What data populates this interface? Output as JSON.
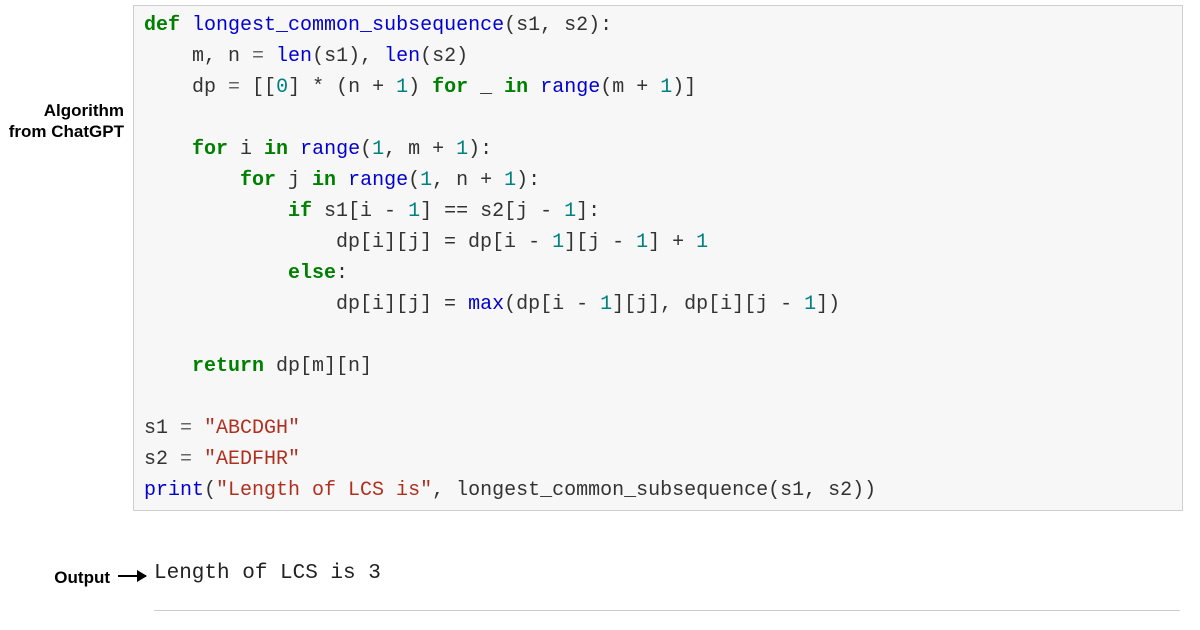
{
  "labels": {
    "algorithm_line1": "Algorithm",
    "algorithm_line2": "from ChatGPT",
    "output": "Output"
  },
  "code": {
    "line1": {
      "def": "def",
      "fname": "longest_common_subsequence",
      "params": "(s1, s2):"
    },
    "line2": {
      "lhs": "m, n",
      "eq": " = ",
      "len1": "len",
      "a1": "(s1), ",
      "len2": "len",
      "a2": "(s2)"
    },
    "line3": {
      "dp": "dp",
      "eq": " = ",
      "open": "[[",
      "zero": "0",
      "rest1": "] * (n + ",
      "one1": "1",
      "rest2": ") ",
      "for": "for",
      "under": " _ ",
      "in": "in",
      "sp": " ",
      "range": "range",
      "rest3": "(m + ",
      "one2": "1",
      "rest4": ")]"
    },
    "line5": {
      "for": "for",
      "var": " i ",
      "in": "in",
      "sp": " ",
      "range": "range",
      "args": "(",
      "one": "1",
      "rest": ", m + ",
      "one2": "1",
      "close": "):"
    },
    "line6": {
      "for": "for",
      "var": " j ",
      "in": "in",
      "sp": " ",
      "range": "range",
      "args": "(",
      "one": "1",
      "rest": ", n + ",
      "one2": "1",
      "close": "):"
    },
    "line7": {
      "if": "if",
      "cond1": " s1[i - ",
      "n1": "1",
      "mid": "] == s2[j - ",
      "n2": "1",
      "end": "]:"
    },
    "line8": {
      "lhs": "dp[i][j] = dp[i - ",
      "n1": "1",
      "mid": "][j - ",
      "n2": "1",
      "plus": "] + ",
      "n3": "1"
    },
    "line9": {
      "else": "else",
      "colon": ":"
    },
    "line10": {
      "lhs": "dp[i][j] = ",
      "max": "max",
      "args1": "(dp[i - ",
      "n1": "1",
      "mid": "][j], dp[i][j - ",
      "n2": "1",
      "end": "])"
    },
    "line12": {
      "return": "return",
      "expr": " dp[m][n]"
    },
    "line14": {
      "var": "s1",
      "eq": " = ",
      "str": "\"ABCDGH\""
    },
    "line15": {
      "var": "s2",
      "eq": " = ",
      "str": "\"AEDFHR\""
    },
    "line16": {
      "print": "print",
      "open": "(",
      "str": "\"Length of LCS is\"",
      "rest": ", longest_common_subsequence(s1, s2))"
    }
  },
  "output_text": "Length of LCS is 3"
}
